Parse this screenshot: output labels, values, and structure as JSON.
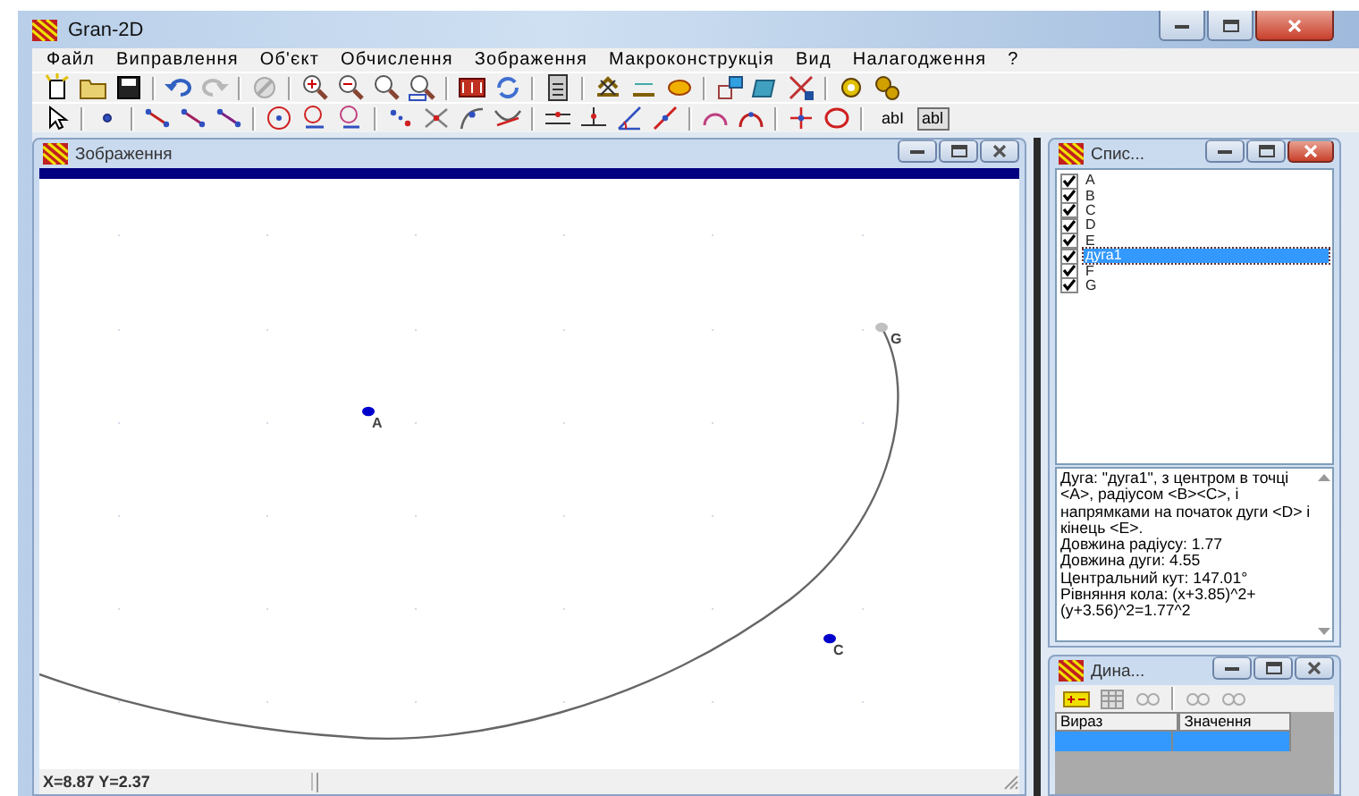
{
  "window": {
    "title": "Gran-2D"
  },
  "menu": [
    "Файл",
    "Виправлення",
    "Об'єкт",
    "Обчислення",
    "Зображення",
    "Макроконструкція",
    "Вид",
    "Налагодження",
    "?"
  ],
  "text_tools": [
    {
      "label": "abI",
      "pressed": false
    },
    {
      "label": "abl",
      "pressed": true
    }
  ],
  "drawing_window": {
    "title": "Зображення",
    "status": "X=8.87 Y=2.37",
    "points": [
      {
        "label": "A",
        "color": "#0000cc"
      },
      {
        "label": "C",
        "color": "#0000cc"
      },
      {
        "label": "G",
        "color": "#c0c0c0"
      }
    ]
  },
  "objects_window": {
    "title": "Спис...",
    "items": [
      {
        "label": "A",
        "checked": true,
        "selected": false
      },
      {
        "label": "B",
        "checked": true,
        "selected": false
      },
      {
        "label": "C",
        "checked": true,
        "selected": false
      },
      {
        "label": "D",
        "checked": true,
        "selected": false
      },
      {
        "label": "E",
        "checked": true,
        "selected": false
      },
      {
        "label": "дуга1",
        "checked": true,
        "selected": true
      },
      {
        "label": "F",
        "checked": true,
        "selected": false
      },
      {
        "label": "G",
        "checked": true,
        "selected": false
      }
    ],
    "info": [
      "Дуга: \"дуга1\", з центром в точці <A>, радіусом <B><C>, і напрямками на початок дуги <D> і кінець <E>.",
      "Довжина радіусу: 1.77",
      "Довжина дуги: 4.55",
      "Центральний кут: 147.01°",
      "Рівняння кола: (x+3.85)^2+(y+3.56)^2=1.77^2"
    ]
  },
  "dynamics_window": {
    "title": "Дина...",
    "columns": [
      "Вираз",
      "Значення"
    ],
    "rows": [
      {
        "selected": true
      }
    ]
  }
}
